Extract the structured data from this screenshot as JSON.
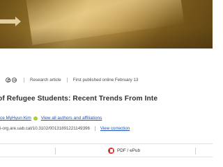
{
  "meta": {
    "article_type": "Research article",
    "published": "First published online February 13"
  },
  "article": {
    "title": "of Refugee Students: Recent Trends From Inte"
  },
  "authors": {
    "name": "ce MyHyun Kim",
    "view_all": "View all authors and affiliations"
  },
  "doi": {
    "text": "i-org.are.uab.cat/10.3102/00131891221149396",
    "correction": "View correction"
  },
  "actions": {
    "pdf_label": "PDF / ePub"
  },
  "colors": {
    "banner_gold": "#c9a659",
    "link_blue": "#1d4fb5",
    "orcid_green": "#a6ce39",
    "pdf_red": "#d6322f"
  }
}
